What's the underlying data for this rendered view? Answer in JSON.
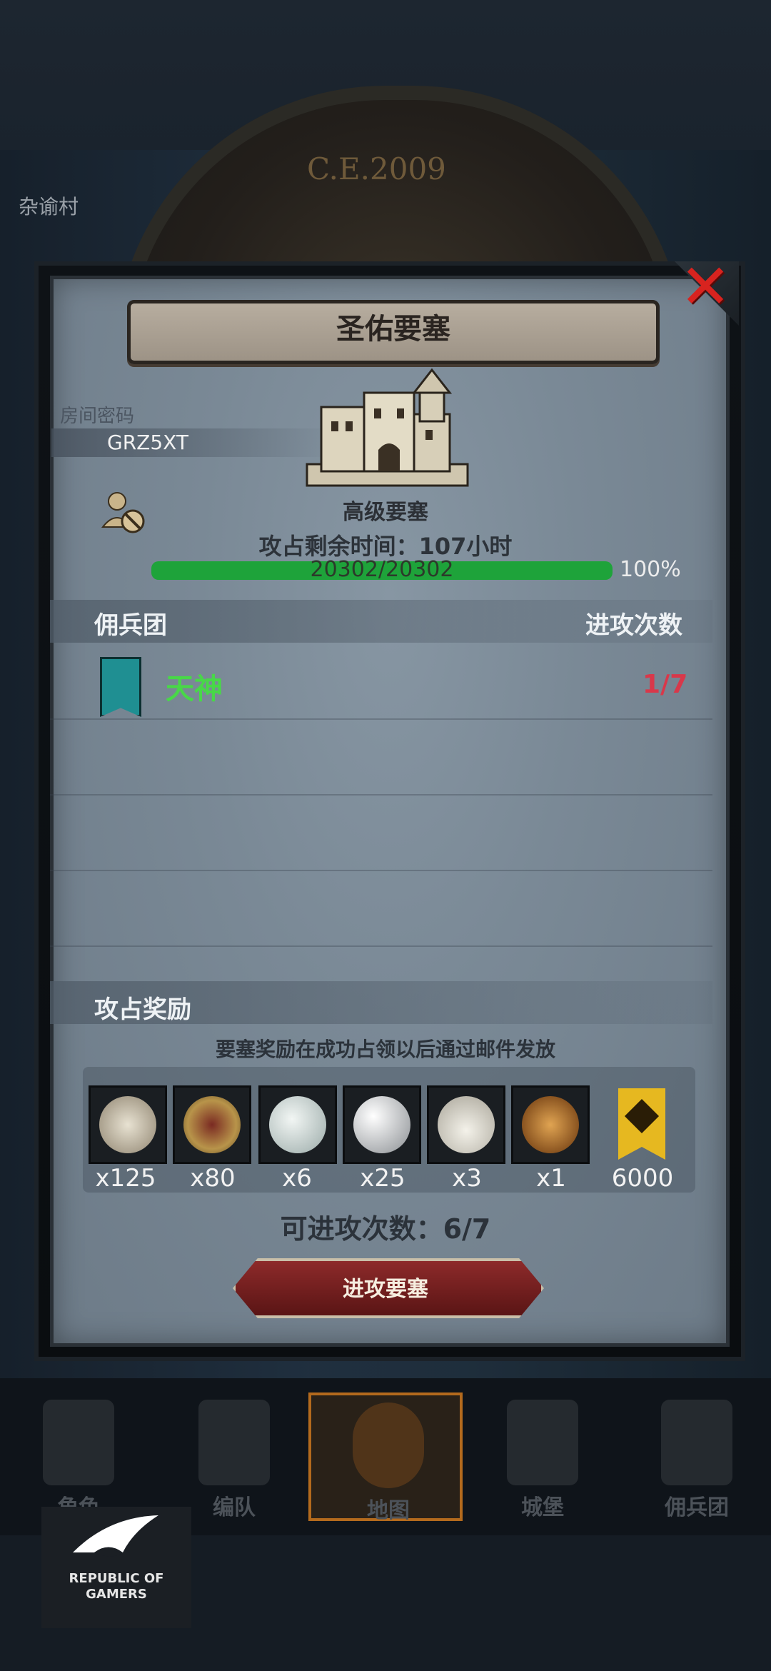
{
  "background": {
    "era_label": "C.E.2009",
    "map_text": "杂谕村"
  },
  "panel": {
    "title": "圣佑要塞",
    "room_code_label": "房间密码",
    "room_code": "GRZ5XT",
    "fortress_type": "高级要塞",
    "time_remaining": "攻占剩余时间：107小时",
    "hp_text": "20302/20302",
    "hp_percent": "100%",
    "hp_fraction": 1.0,
    "mercenary_header": "佣兵团",
    "attack_count_header": "进攻次数",
    "guilds": [
      {
        "name": "天神",
        "attacks": "1/7"
      }
    ],
    "rewards_header": "攻占奖励",
    "rewards_note": "要塞奖励在成功占领以后通过邮件发放",
    "rewards": [
      {
        "icon": "silver-ore-icon",
        "qty": "x125",
        "color": "#cfc7b6"
      },
      {
        "icon": "goblet-icon",
        "qty": "x80",
        "color": "#b8944a"
      },
      {
        "icon": "pearl-stone-icon",
        "qty": "x6",
        "color": "#c7d4d4"
      },
      {
        "icon": "metal-orbs-icon",
        "qty": "x25",
        "color": "#cfd2d4"
      },
      {
        "icon": "salt-pile-icon",
        "qty": "x3",
        "color": "#e2e0d8"
      },
      {
        "icon": "knight-helmet-coin-icon",
        "qty": "x1",
        "color": "#c28a3b"
      },
      {
        "icon": "honor-medal-icon",
        "qty": "6000",
        "color": "#e6b820"
      }
    ],
    "remaining_attacks": "可进攻次数：6/7",
    "attack_button": "进攻要塞"
  },
  "nav": {
    "items": [
      {
        "label": "角色",
        "icon": "knight-icon",
        "active": false
      },
      {
        "label": "编队",
        "icon": "helmet-icon",
        "active": false
      },
      {
        "label": "地图",
        "icon": "map-icon",
        "active": true
      },
      {
        "label": "城堡",
        "icon": "castle-icon",
        "active": false
      },
      {
        "label": "佣兵团",
        "icon": "mercenary-icon",
        "active": false
      }
    ]
  },
  "watermark": {
    "brand": "REPUBLIC OF GAMERS"
  },
  "colors": {
    "hp_bar": "#1ea33a",
    "guild_name": "#48d848",
    "attack_count": "#d8384a",
    "close": "#d8231f"
  }
}
